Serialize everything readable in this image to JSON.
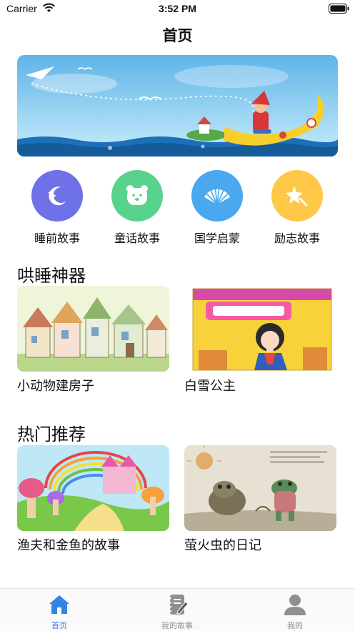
{
  "status": {
    "carrier": "Carrier",
    "time": "3:52 PM"
  },
  "nav": {
    "title": "首页"
  },
  "categories": [
    {
      "label": "睡前故事",
      "icon": "moon-stars-icon",
      "color": "#6f71e8"
    },
    {
      "label": "童话故事",
      "icon": "bear-face-icon",
      "color": "#57d38c"
    },
    {
      "label": "国学启蒙",
      "icon": "shell-icon",
      "color": "#49a8ef"
    },
    {
      "label": "励志故事",
      "icon": "sparkle-icon",
      "color": "#ffc848"
    }
  ],
  "sections": [
    {
      "title": "哄睡神器",
      "items": [
        {
          "title": "小动物建房子"
        },
        {
          "title": "白雪公主"
        }
      ]
    },
    {
      "title": "热门推荐",
      "items": [
        {
          "title": "渔夫和金鱼的故事"
        },
        {
          "title": "萤火虫的日记"
        }
      ]
    }
  ],
  "tabbar": {
    "items": [
      {
        "label": "首页",
        "icon": "home-icon",
        "active": true
      },
      {
        "label": "我的故事",
        "icon": "notebook-icon",
        "active": false
      },
      {
        "label": "我的",
        "icon": "person-icon",
        "active": false
      }
    ],
    "active_color": "#3584e4",
    "inactive_color": "#8e8e93"
  }
}
